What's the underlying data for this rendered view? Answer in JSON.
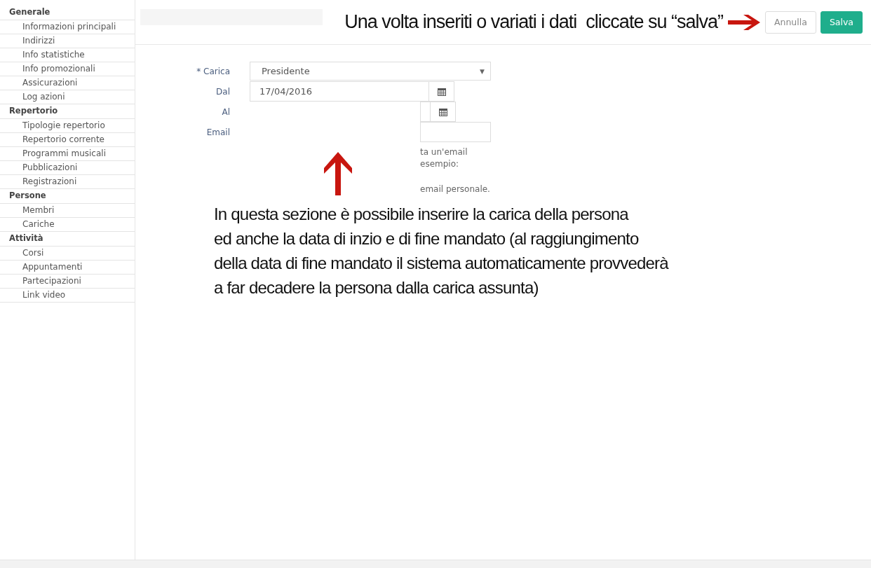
{
  "sidebar": {
    "groups": [
      {
        "title": "Generale",
        "items": [
          "Informazioni principali",
          "Indirizzi",
          "Info statistiche",
          "Info promozionali",
          "Assicurazioni",
          "Log azioni"
        ]
      },
      {
        "title": "Repertorio",
        "items": [
          "Tipologie repertorio",
          "Repertorio corrente",
          "Programmi musicali",
          "Pubblicazioni",
          "Registrazioni"
        ]
      },
      {
        "title": "Persone",
        "items": [
          "Membri",
          "Cariche"
        ]
      },
      {
        "title": "Attività",
        "items": [
          "Corsi",
          "Appuntamenti",
          "Partecipazioni",
          "Link video"
        ]
      }
    ]
  },
  "toolbar": {
    "annotation": "Una volta inseriti o variati i dati  cliccate su “salva”",
    "buttons": [
      {
        "label": "Annulla",
        "kind": "default"
      },
      {
        "label": "Salva",
        "kind": "primary"
      }
    ]
  },
  "form": {
    "fields": [
      {
        "label": "* Carica",
        "kind": "select",
        "value": "Presidente",
        "caret": "▼"
      },
      {
        "label": "Dal",
        "kind": "date",
        "value": "17/04/2016"
      },
      {
        "label": "Al",
        "kind": "date-partial"
      },
      {
        "label": "Email",
        "kind": "text-partial"
      }
    ],
    "help_lines": [
      "ta un'email",
      "esempio:",
      "email personale."
    ]
  },
  "annotation": "In questa sezione è possibile inserire la carica  della persona\ned anche la data di inzio e di fine mandato (al raggiungimento\ndella data di fine mandato il sistema automaticamente provvederà\na far decadere la persona dalla carica assunta)"
}
